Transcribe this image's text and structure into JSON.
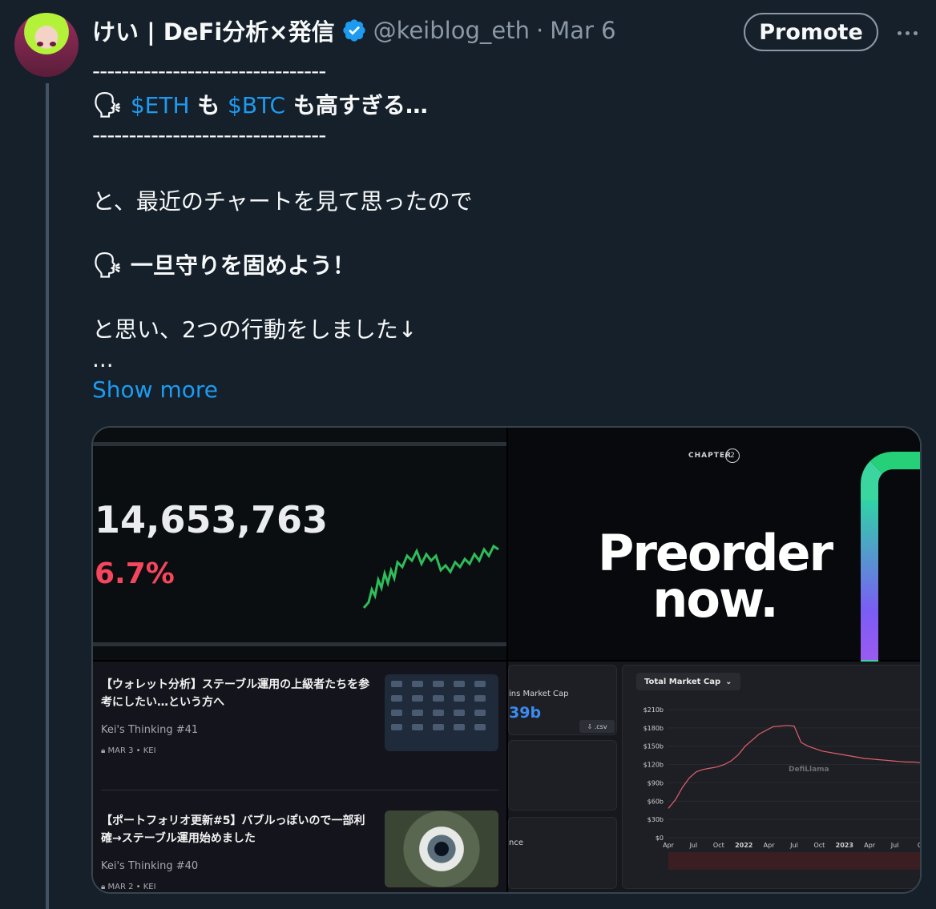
{
  "author": {
    "name": "けい | DeFi分析×発信",
    "handle": "@keiblog_eth",
    "separator": "·",
    "date": "Mar 6"
  },
  "actions": {
    "promote_label": "Promote"
  },
  "post": {
    "dashes": "--------------------------------",
    "headline_cashtag1": "$ETH",
    "headline_mid": "も",
    "headline_cashtag2": "$BTC",
    "headline_tail": "も高すぎる…",
    "line1": "と、最近のチャートを見て思ったので",
    "line2": "一旦守りを固めよう！",
    "line3": "と思い、2つの行動をしました↓",
    "ellipsis": "...",
    "show_more": "Show more"
  },
  "media": {
    "price_panel": {
      "big_number": "14,653,763",
      "change": "6.7%"
    },
    "promo_panel": {
      "chapter_label": "CHAPTER",
      "chapter_number": "2",
      "headline_line1": "Preorder",
      "headline_line2": "now."
    },
    "articles": [
      {
        "title": "【ウォレット分析】ステーブル運用の上級者たちを参考にしたい…という方へ",
        "series": "Kei's Thinking #41",
        "meta": "MAR 3 • KEI"
      },
      {
        "title": "【ポートフォリオ更新#5】バブルっぽいので一部利確→ステーブル運用始めました",
        "series": "Kei's Thinking #40",
        "meta": "MAR 2 • KEI"
      }
    ],
    "defi_panel": {
      "market_cap_label": "ins Market Cap",
      "market_cap_value": "39b",
      "csv_label": ".csv",
      "partial_label": "nce",
      "chart_selector": "Total Market Cap",
      "watermark": "DefiLlama"
    }
  },
  "chart_data": {
    "type": "line",
    "title": "",
    "xlabel": "",
    "ylabel": "",
    "y_ticks": [
      "$0",
      "$30b",
      "$60b",
      "$90b",
      "$120b",
      "$150b",
      "$180b",
      "$210b"
    ],
    "x_ticks": [
      "Apr",
      "Jul",
      "Oct",
      "2022",
      "Apr",
      "Jul",
      "Oct",
      "2023",
      "Apr",
      "Jul",
      "O"
    ],
    "ylim": [
      0,
      210
    ],
    "series": [
      {
        "values": [
          48,
          62,
          82,
          98,
          108,
          112,
          114,
          116,
          120,
          126,
          136,
          150,
          160,
          170,
          176,
          182,
          183,
          184,
          183,
          156,
          150,
          146,
          142,
          140,
          138,
          136,
          134,
          132,
          130,
          129,
          128,
          127,
          126,
          125,
          124,
          124,
          123
        ]
      }
    ],
    "grid": true,
    "color": "#e0606a"
  },
  "colors": {
    "background": "#15202b",
    "accent": "#1d9bf0",
    "verified": "#1d9bf0",
    "price_up_line": "#2ebd5a",
    "change_red": "#f6465d"
  }
}
